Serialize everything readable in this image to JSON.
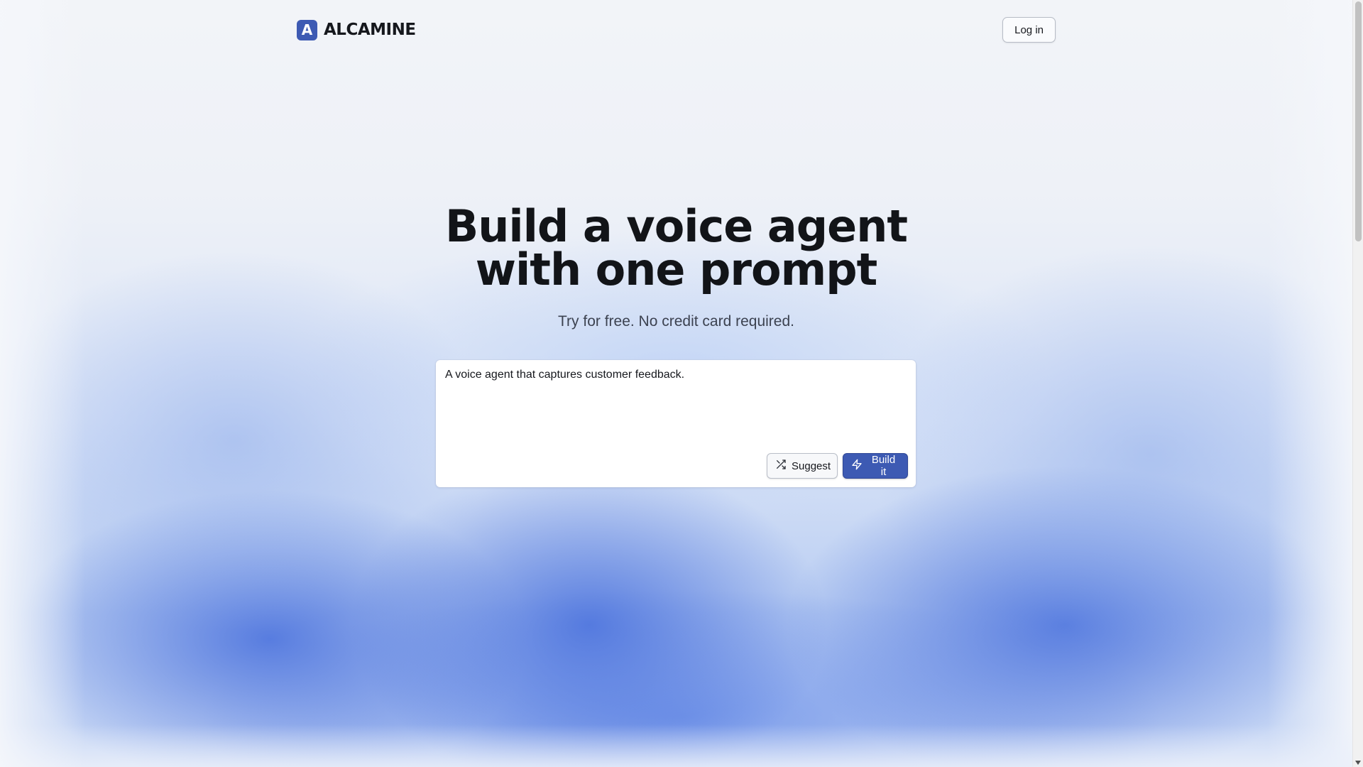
{
  "brand": {
    "logo_letter": "A",
    "name": "ALCAMINE",
    "accent_color": "#3d5ab3"
  },
  "header": {
    "login_label": "Log in"
  },
  "hero": {
    "title_line1": "Build a voice agent",
    "title_line2": "with one prompt",
    "subtitle": "Try for free. No credit card required."
  },
  "prompt": {
    "value": "A voice agent that captures customer feedback.",
    "suggest_label": "Suggest",
    "suggest_icon": "shuffle-icon",
    "build_label": "Build it",
    "build_icon": "lightning-icon"
  }
}
